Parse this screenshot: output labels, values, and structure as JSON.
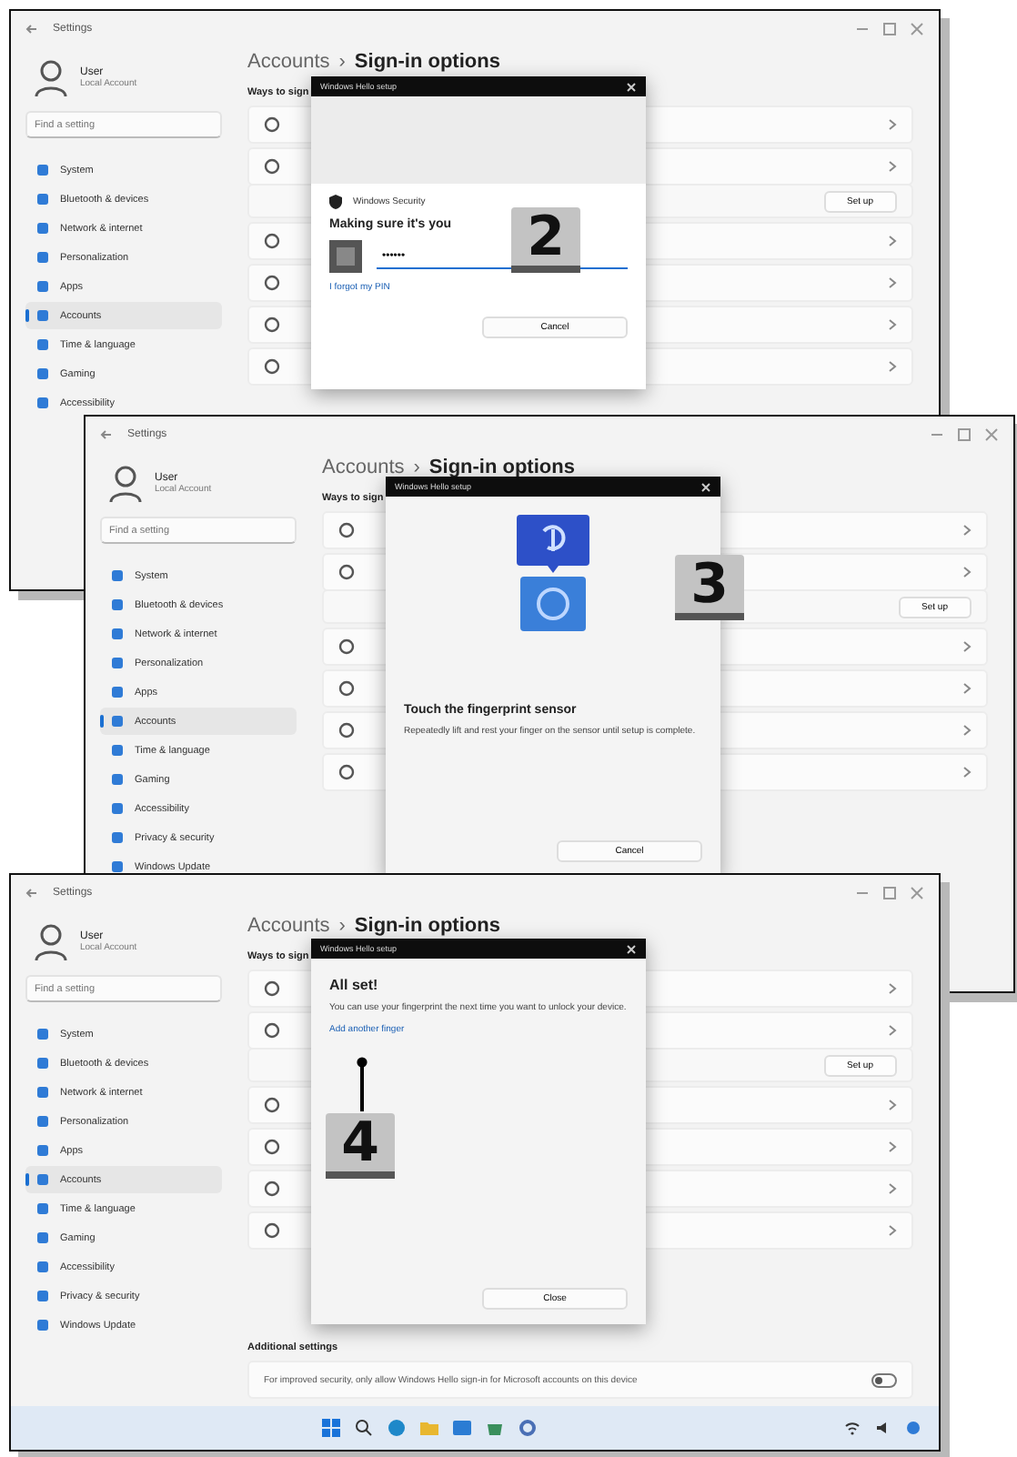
{
  "windows": [
    {
      "title": "Settings",
      "user": {
        "name": "User",
        "account": "Local Account"
      },
      "search": {
        "placeholder": "Find a setting"
      },
      "nav": [
        {
          "label": "System",
          "selected": false
        },
        {
          "label": "Bluetooth & devices",
          "selected": false
        },
        {
          "label": "Network & internet",
          "selected": false
        },
        {
          "label": "Personalization",
          "selected": false
        },
        {
          "label": "Apps",
          "selected": false
        },
        {
          "label": "Accounts",
          "selected": true
        },
        {
          "label": "Time & language",
          "selected": false
        },
        {
          "label": "Gaming",
          "selected": false
        },
        {
          "label": "Accessibility",
          "selected": false
        }
      ],
      "breadcrumb": {
        "parent": "Accounts",
        "separator": "›",
        "current": "Sign-in options"
      },
      "section_label": "Ways to sign",
      "row_button": "Set up",
      "dialog": {
        "kind": "verify",
        "title": "Windows Hello setup",
        "source": "Windows Security",
        "heading": "Making sure it's you",
        "value": "••••••",
        "link": "I forgot my PIN",
        "button": "Cancel"
      },
      "step": "2"
    },
    {
      "title": "Settings",
      "user": {
        "name": "User",
        "account": "Local Account"
      },
      "search": {
        "placeholder": "Find a setting"
      },
      "nav": [
        {
          "label": "System",
          "selected": false
        },
        {
          "label": "Bluetooth & devices",
          "selected": false
        },
        {
          "label": "Network & internet",
          "selected": false
        },
        {
          "label": "Personalization",
          "selected": false
        },
        {
          "label": "Apps",
          "selected": false
        },
        {
          "label": "Accounts",
          "selected": true
        },
        {
          "label": "Time & language",
          "selected": false
        },
        {
          "label": "Gaming",
          "selected": false
        },
        {
          "label": "Accessibility",
          "selected": false
        },
        {
          "label": "Privacy & security",
          "selected": false
        },
        {
          "label": "Windows Update",
          "selected": false
        }
      ],
      "breadcrumb": {
        "parent": "Accounts",
        "separator": "›",
        "current": "Sign-in options"
      },
      "section_label": "Ways to sign",
      "row_button": "Set up",
      "dialog": {
        "kind": "fingerprint",
        "title": "Windows Hello setup",
        "heading": "Touch the fingerprint sensor",
        "text": "Repeatedly lift and rest your finger on the sensor until setup is complete.",
        "button": "Cancel"
      },
      "step": "3"
    },
    {
      "title": "Settings",
      "user": {
        "name": "User",
        "account": "Local Account"
      },
      "search": {
        "placeholder": "Find a setting"
      },
      "nav": [
        {
          "label": "System",
          "selected": false
        },
        {
          "label": "Bluetooth & devices",
          "selected": false
        },
        {
          "label": "Network & internet",
          "selected": false
        },
        {
          "label": "Personalization",
          "selected": false
        },
        {
          "label": "Apps",
          "selected": false
        },
        {
          "label": "Accounts",
          "selected": true
        },
        {
          "label": "Time & language",
          "selected": false
        },
        {
          "label": "Gaming",
          "selected": false
        },
        {
          "label": "Accessibility",
          "selected": false
        },
        {
          "label": "Privacy & security",
          "selected": false
        },
        {
          "label": "Windows Update",
          "selected": false
        }
      ],
      "breadcrumb": {
        "parent": "Accounts",
        "separator": "›",
        "current": "Sign-in options"
      },
      "section_label": "Ways to sign",
      "row_button": "Set up",
      "dialog": {
        "kind": "done",
        "title": "Windows Hello setup",
        "heading": "All set!",
        "text": "You can use your fingerprint the next time you want to unlock your device.",
        "link": "Add another finger",
        "button": "Close"
      },
      "additional": {
        "heading": "Additional settings",
        "text": "For improved security, only allow Windows Hello sign-in for Microsoft accounts on this device",
        "on": false
      },
      "taskbar": true,
      "step": "4"
    }
  ]
}
